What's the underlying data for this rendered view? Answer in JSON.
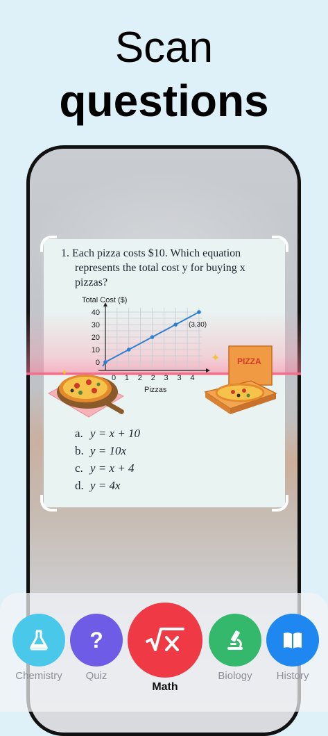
{
  "hero": {
    "line1": "Scan",
    "line2": "questions"
  },
  "question": {
    "number": "1.",
    "line1": "Each pizza costs $10. Which equation",
    "line2": "represents the total cost y for buying x",
    "line3": "pizzas?"
  },
  "chart_data": {
    "type": "line",
    "ylabel": "Total Cost ($)",
    "xlabel": "Pizzas",
    "x": [
      0,
      1,
      2,
      3,
      4
    ],
    "y": [
      0,
      10,
      20,
      30,
      40
    ],
    "xticks": [
      "0",
      "1",
      "2",
      "2",
      "3",
      "3",
      "4"
    ],
    "yticks": [
      "0",
      "10",
      "20",
      "30",
      "40"
    ],
    "ylim": [
      0,
      40
    ],
    "annotation": "(3,30)",
    "grid": true
  },
  "illustrations": {
    "box_label": "PIZZA"
  },
  "choices": [
    {
      "label": "a.",
      "equation": "y = x + 10"
    },
    {
      "label": "b.",
      "equation": "y = 10x"
    },
    {
      "label": "c.",
      "equation": "y = x + 4"
    },
    {
      "label": "d.",
      "equation": "y = 4x"
    }
  ],
  "tabs": [
    {
      "label": "Chemistry",
      "icon": "flask-icon",
      "color": "#4ac8ea"
    },
    {
      "label": "Quiz",
      "icon": "question-icon",
      "color": "#6e5ce6"
    },
    {
      "label": "Math",
      "icon": "sqrt-x-icon",
      "color": "#ef3a45"
    },
    {
      "label": "Biology",
      "icon": "microscope-icon",
      "color": "#34b86c"
    },
    {
      "label": "History",
      "icon": "book-icon",
      "color": "#1e88f0"
    }
  ],
  "active_tab": "Math"
}
